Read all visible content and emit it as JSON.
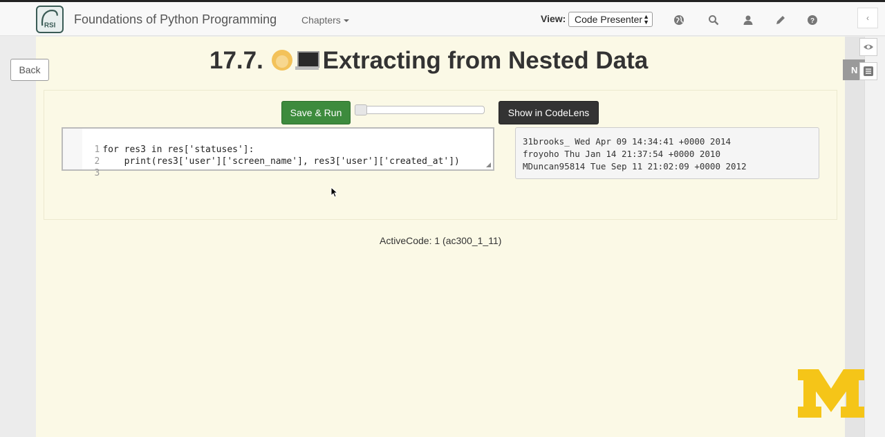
{
  "navbar": {
    "brand": "Foundations of Python Programming",
    "logo_text": "RSI",
    "chapters_label": "Chapters",
    "view_label": "View:",
    "view_selected": "Code Presenter"
  },
  "page": {
    "back_label": "Back",
    "title_prefix": "17.7.",
    "title_text": "Extracting from Nested Data",
    "note_tab_label": "N"
  },
  "activecode": {
    "run_label": "Save & Run",
    "codelens_label": "Show in CodeLens",
    "caption": "ActiveCode: 1 (ac300_1_11)",
    "code_lines": [
      {
        "num": "1",
        "text": "for res3 in res['statuses']:"
      },
      {
        "num": "2",
        "text": "    print(res3['user']['screen_name'], res3['user']['created_at'])"
      },
      {
        "num": "3",
        "text": ""
      }
    ],
    "output_lines": [
      "31brooks_ Wed Apr 09 14:34:41 +0000 2014",
      "froyoho Thu Jan 14 21:37:54 +0000 2010",
      "MDuncan95814 Tue Sep 11 21:02:09 +0000 2012"
    ]
  },
  "icons": [
    "globe-icon",
    "search-icon",
    "user-icon",
    "pencil-icon",
    "help-icon",
    "eye-icon",
    "notes-icon",
    "chevron-left-icon"
  ],
  "colors": {
    "run_button": "#3d8b3d",
    "codelens_button": "#333333",
    "page_background": "#fbf9e6",
    "umich_maize": "#f5c518"
  }
}
